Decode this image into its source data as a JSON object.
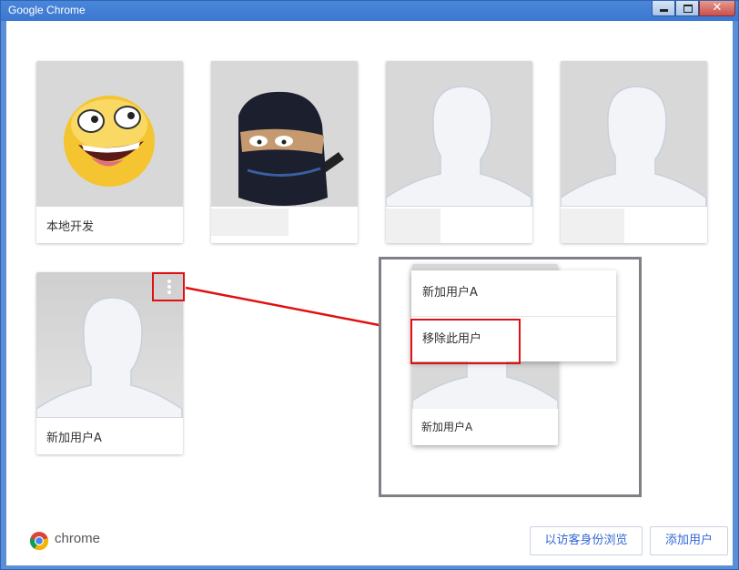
{
  "window": {
    "title": "Google Chrome",
    "close_glyph": "✕"
  },
  "profiles": [
    {
      "name": "本地开发",
      "avatar": "smiley-avatar"
    },
    {
      "name": "",
      "avatar": "ninja-avatar"
    },
    {
      "name": "",
      "avatar": "silhouette-avatar"
    },
    {
      "name": "",
      "avatar": "silhouette-avatar"
    },
    {
      "name": "新加用户A",
      "avatar": "silhouette-avatar"
    }
  ],
  "context_menu": {
    "items": [
      "新加用户A",
      "移除此用户"
    ]
  },
  "zoom_card": {
    "name": "新加用户A"
  },
  "footer": {
    "brand": "chrome",
    "guest_button": "以访客身份浏览",
    "add_button": "添加用户"
  },
  "colors": {
    "accent": "#3367d6",
    "highlight": "#e01010",
    "titlebar": "#4a86d8"
  }
}
